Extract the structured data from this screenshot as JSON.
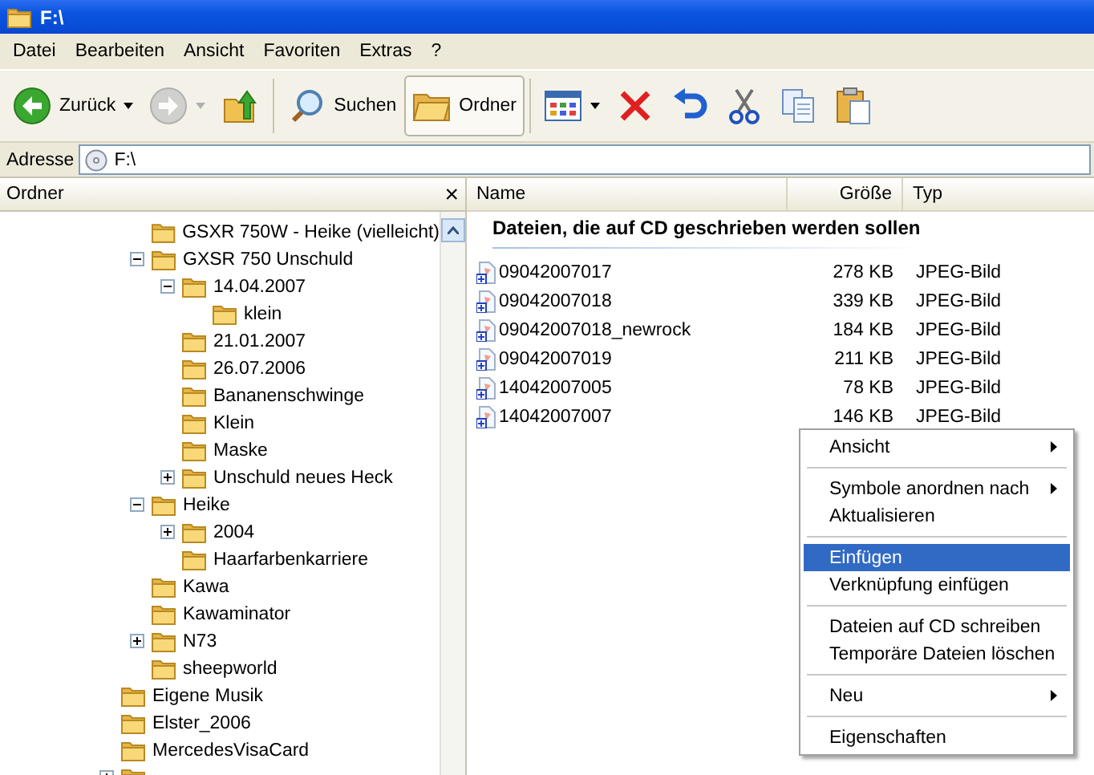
{
  "window": {
    "title": "F:\\"
  },
  "menu_bar": [
    "Datei",
    "Bearbeiten",
    "Ansicht",
    "Favoriten",
    "Extras",
    "?"
  ],
  "toolbar": {
    "buttons": [
      {
        "kind": "back",
        "label": "Zurück",
        "dropdown": true,
        "disabled": false,
        "pressed": false
      },
      {
        "kind": "forward",
        "dropdown": true,
        "disabled": true,
        "pressed": false
      },
      {
        "kind": "up",
        "dropdown": false,
        "disabled": false,
        "pressed": false
      },
      {
        "kind": "search",
        "label": "Suchen",
        "dropdown": false,
        "disabled": false,
        "pressed": false
      },
      {
        "kind": "folders",
        "label": "Ordner",
        "dropdown": false,
        "disabled": false,
        "pressed": true
      },
      {
        "kind": "views",
        "dropdown": true,
        "disabled": false,
        "pressed": false
      },
      {
        "kind": "delete",
        "dropdown": false,
        "disabled": false,
        "pressed": false
      },
      {
        "kind": "undo",
        "dropdown": false,
        "disabled": false,
        "pressed": false
      },
      {
        "kind": "cut",
        "dropdown": false,
        "disabled": false,
        "pressed": false
      },
      {
        "kind": "copy",
        "dropdown": false,
        "disabled": false,
        "pressed": false
      },
      {
        "kind": "paste",
        "dropdown": false,
        "disabled": false,
        "pressed": false
      }
    ]
  },
  "address_bar": {
    "label": "Adresse",
    "value": "F:\\"
  },
  "folder_pane": {
    "title": "Ordner",
    "close": "×"
  },
  "tree": {
    "continued": [
      {
        "label": "GSXR 750W - Heike (vielleicht)",
        "kind": "leaf"
      },
      {
        "label": "GXSR 750 Unschuld",
        "kind": "branch",
        "expanded": true,
        "children": [
          {
            "label": "14.04.2007",
            "kind": "branch",
            "expanded": true,
            "children": [
              {
                "label": "klein",
                "kind": "leaf"
              }
            ]
          },
          {
            "label": "21.01.2007",
            "kind": "leaf"
          },
          {
            "label": "26.07.2006",
            "kind": "leaf"
          },
          {
            "label": "Bananenschwinge",
            "kind": "leaf"
          },
          {
            "label": "Klein",
            "kind": "leaf"
          },
          {
            "label": "Maske",
            "kind": "leaf"
          },
          {
            "label": "Unschuld neues Heck",
            "kind": "branch",
            "expanded": false
          }
        ]
      },
      {
        "label": "Heike",
        "kind": "branch",
        "expanded": true,
        "children": [
          {
            "label": "2004",
            "kind": "branch",
            "expanded": false
          },
          {
            "label": "Haarfarbenkarriere",
            "kind": "leaf"
          }
        ]
      },
      {
        "label": "Kawa",
        "kind": "leaf"
      },
      {
        "label": "Kawaminator",
        "kind": "leaf"
      },
      {
        "label": "N73",
        "kind": "branch",
        "expanded": false
      },
      {
        "label": "sheepworld",
        "kind": "leaf"
      }
    ],
    "items": [
      {
        "label": "Eigene Musik",
        "kind": "leaf"
      },
      {
        "label": "Elster_2006",
        "kind": "leaf"
      },
      {
        "label": "MercedesVisaCard",
        "kind": "leaf"
      },
      {
        "kind": "branch",
        "expanded": false
      }
    ]
  },
  "file_list": {
    "columns": [
      "Name",
      "Größe",
      "Typ"
    ],
    "group": "Dateien, die auf CD geschrieben werden sollen",
    "rows": [
      {
        "name": "09042007017",
        "size": "278 KB",
        "type": "JPEG-Bild"
      },
      {
        "name": "09042007018",
        "size": "339 KB",
        "type": "JPEG-Bild"
      },
      {
        "name": "09042007018_newrock",
        "size": "184 KB",
        "type": "JPEG-Bild"
      },
      {
        "name": "09042007019",
        "size": "211 KB",
        "type": "JPEG-Bild"
      },
      {
        "name": "14042007005",
        "size": "78 KB",
        "type": "JPEG-Bild"
      },
      {
        "name": "14042007007",
        "size": "146 KB",
        "type": "JPEG-Bild"
      }
    ]
  },
  "context_menu": [
    {
      "kind": "item",
      "label": "Ansicht",
      "submenu": true,
      "selected": false
    },
    {
      "kind": "separator"
    },
    {
      "kind": "item",
      "label": "Symbole anordnen nach",
      "submenu": true,
      "selected": false
    },
    {
      "kind": "item",
      "label": "Aktualisieren",
      "submenu": false,
      "selected": false
    },
    {
      "kind": "separator"
    },
    {
      "kind": "item",
      "label": "Einfügen",
      "submenu": false,
      "selected": true
    },
    {
      "kind": "item",
      "label": "Verknüpfung einfügen",
      "submenu": false,
      "selected": false
    },
    {
      "kind": "separator"
    },
    {
      "kind": "item",
      "label": "Dateien auf CD schreiben",
      "submenu": false,
      "selected": false
    },
    {
      "kind": "item",
      "label": "Temporäre Dateien löschen",
      "submenu": false,
      "selected": false
    },
    {
      "kind": "separator"
    },
    {
      "kind": "item",
      "label": "Neu",
      "submenu": true,
      "selected": false
    },
    {
      "kind": "separator"
    },
    {
      "kind": "item",
      "label": "Eigenschaften",
      "submenu": false,
      "selected": false
    }
  ]
}
